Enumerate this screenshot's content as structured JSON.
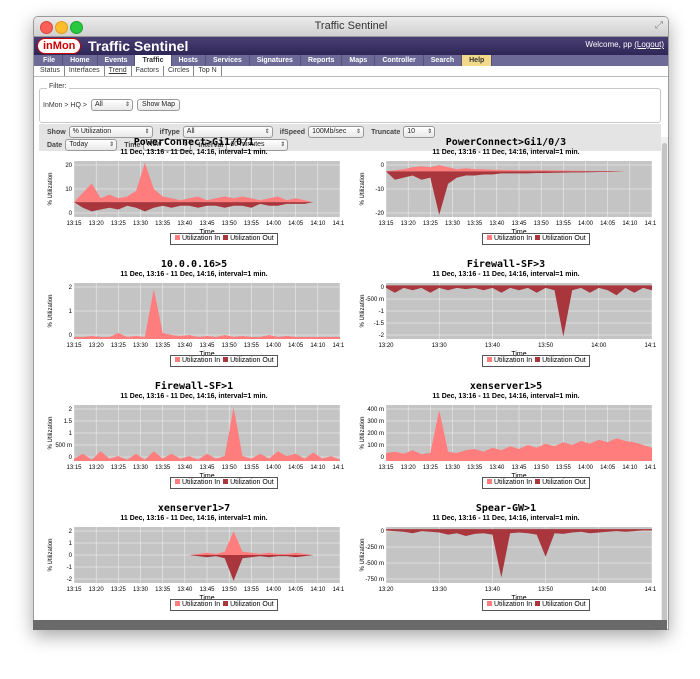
{
  "window": {
    "title": "Traffic Sentinel"
  },
  "brand": {
    "logo": "inMon",
    "app": "Traffic Sentinel",
    "welcome": "Welcome, pp",
    "logout": "(Logout)"
  },
  "menu": [
    "File",
    "Home",
    "Events",
    "Traffic",
    "Hosts",
    "Services",
    "Signatures",
    "Reports",
    "Maps",
    "Controller",
    "Search",
    "Help"
  ],
  "menu_active": "Traffic",
  "submenu": [
    "Status",
    "Interfaces",
    "Trend",
    "Factors",
    "Circles",
    "Top N"
  ],
  "submenu_active": "Trend",
  "filter": {
    "legend": "Filter:",
    "path": "InMon > HQ >",
    "scope": "All",
    "show_map": "Show Map"
  },
  "controls": {
    "show_label": "Show",
    "show_value": "% Utilization",
    "iftype_label": "ifType",
    "iftype_value": "All",
    "ifspeed_label": "ifSpeed",
    "ifspeed_value": "100Mb/sec",
    "truncate_label": "Truncate",
    "truncate_value": "10",
    "date_label": "Date",
    "date_value": "Today",
    "time_label": "Time",
    "time_value": "Now",
    "interval_label": "Interval",
    "interval_value": "60 minutes"
  },
  "common": {
    "subtitle": "11 Dec, 13:16 -  11 Dec, 14:16, interval=1 min.",
    "xlabel": "Time",
    "ylabel": "% Utilization",
    "legend_in": "Utilization In",
    "legend_out": "Utilization Out",
    "color_in": "#ff7d7d",
    "color_out": "#a8363c",
    "plot_bg": "#c4c4c4"
  },
  "chart_data": [
    {
      "type": "area",
      "title": "PowerConnect>Gi1/0/1",
      "xticks": [
        "13:15",
        "13:20",
        "13:25",
        "13:30",
        "13:35",
        "13:40",
        "13:45",
        "13:50",
        "13:55",
        "14:00",
        "14:05",
        "14:10",
        "14:15"
      ],
      "yticks": [
        "20",
        "10",
        "0"
      ],
      "ylim": [
        -8,
        22
      ],
      "in": [
        0,
        5,
        10,
        2,
        4,
        2,
        3,
        6,
        21,
        7,
        3,
        2,
        1,
        2,
        3,
        1,
        2,
        3,
        2,
        3,
        2,
        1,
        2,
        3,
        1,
        2,
        1,
        0,
        0,
        0,
        0
      ],
      "out": [
        0,
        -3,
        -5,
        -4,
        -3,
        -4,
        -2,
        -3,
        -5,
        -3,
        -2,
        -3,
        -2,
        -2,
        -3,
        -2,
        -2,
        -3,
        -2,
        -2,
        -3,
        -1,
        -2,
        -2,
        -1,
        -1,
        -1,
        0,
        0,
        0,
        0
      ]
    },
    {
      "type": "area",
      "title": "PowerConnect>Gi1/0/3",
      "xticks": [
        "13:15",
        "13:20",
        "13:25",
        "13:30",
        "13:35",
        "13:40",
        "13:45",
        "13:50",
        "13:55",
        "14:00",
        "14:05",
        "14:10",
        "14:15"
      ],
      "yticks": [
        "0",
        "-10",
        "-20"
      ],
      "ylim": [
        -22,
        5
      ],
      "in": [
        0,
        0.5,
        1,
        2,
        2.5,
        2,
        3,
        2,
        1,
        1.5,
        1,
        1,
        0.8,
        0.7,
        0.6,
        0.5,
        0.5,
        0.5,
        0.5,
        0.4,
        0.4,
        0.3,
        0.3,
        0.2,
        0.2,
        0.2,
        0.1,
        0,
        0,
        0,
        0
      ],
      "out": [
        0,
        -4,
        -3,
        -2,
        -4,
        -3,
        -21,
        -6,
        -3,
        -2,
        -2,
        -1.5,
        -1.5,
        -1,
        -1,
        -1,
        -1,
        -0.8,
        -0.8,
        -0.7,
        -0.6,
        -0.5,
        -0.5,
        -0.4,
        -0.3,
        -0.3,
        -0.2,
        0,
        0,
        0,
        0
      ]
    },
    {
      "type": "area",
      "title": "10.0.0.16>5",
      "xticks": [
        "13:15",
        "13:20",
        "13:25",
        "13:30",
        "13:35",
        "13:40",
        "13:45",
        "13:50",
        "13:55",
        "14:00",
        "14:05",
        "14:10",
        "14:15"
      ],
      "yticks": [
        "2",
        "1",
        "0"
      ],
      "ylim": [
        0,
        2.8
      ],
      "in": [
        0.1,
        0.1,
        0.15,
        0.1,
        0.1,
        0.3,
        0.1,
        0.15,
        0.1,
        2.5,
        0.3,
        0.2,
        0.15,
        0.2,
        0.1,
        0.15,
        0.1,
        0.2,
        0.1,
        0.15,
        0.1,
        0.1,
        0.2,
        0.1,
        0.15,
        0.1,
        0.1,
        0.1,
        0.1,
        0.1,
        0.1
      ],
      "out": [
        0,
        0,
        0,
        0,
        0,
        0,
        0,
        0,
        0,
        0,
        0,
        0,
        0,
        0,
        0,
        0,
        0,
        0,
        0,
        0,
        0,
        0,
        0,
        0,
        0,
        0,
        0,
        0,
        0,
        0,
        0
      ]
    },
    {
      "type": "area",
      "title": "Firewall-SF>3",
      "xticks": [
        "13:20",
        "13:30",
        "13:40",
        "13:50",
        "14:00",
        "14:10"
      ],
      "yticks": [
        "0",
        "-500 m",
        "-1",
        "-1.5",
        "-2"
      ],
      "ylim": [
        -2.2,
        0.1
      ],
      "in": [
        0,
        0,
        0,
        0,
        0,
        0,
        0,
        0,
        0,
        0,
        0,
        0,
        0,
        0,
        0,
        0,
        0,
        0,
        0,
        0,
        0,
        0,
        0,
        0,
        0,
        0,
        0,
        0,
        0,
        0,
        0
      ],
      "out": [
        -0.1,
        -0.3,
        -0.1,
        -0.2,
        -0.1,
        -0.3,
        -0.1,
        -0.2,
        -0.1,
        -0.15,
        -0.1,
        -0.2,
        -0.1,
        -0.3,
        -0.1,
        -0.2,
        -0.1,
        -0.3,
        -0.1,
        -0.2,
        -2.1,
        -0.2,
        -0.1,
        -0.3,
        -0.1,
        -0.2,
        -0.4,
        -0.1,
        -0.3,
        -0.1,
        -0.2
      ]
    },
    {
      "type": "area",
      "title": "Firewall-SF>1",
      "xticks": [
        "13:15",
        "13:20",
        "13:25",
        "13:30",
        "13:35",
        "13:40",
        "13:45",
        "13:50",
        "13:55",
        "14:00",
        "14:05",
        "14:10",
        "14:15"
      ],
      "yticks": [
        "2",
        "1.5",
        "1",
        "500 m",
        "0"
      ],
      "ylim": [
        0,
        2.3
      ],
      "in": [
        0.1,
        0.3,
        0.05,
        0.4,
        0.1,
        0.2,
        0.05,
        0.3,
        0.05,
        0.4,
        0.1,
        0.3,
        0.1,
        0.2,
        0.05,
        0.3,
        0.1,
        0.2,
        2.2,
        0.2,
        0.1,
        0.3,
        0.1,
        0.4,
        0.2,
        0.3,
        0.1,
        0.35,
        0.1,
        0.2,
        0.05
      ],
      "out": [
        0,
        0,
        0,
        0,
        0,
        0,
        0,
        0,
        0,
        0,
        0,
        0,
        0,
        0,
        0,
        0,
        0,
        0,
        0,
        0,
        0,
        0,
        0,
        0,
        0,
        0,
        0,
        0,
        0,
        0,
        0
      ]
    },
    {
      "type": "area",
      "title": "xenserver1>5",
      "xticks": [
        "13:15",
        "13:20",
        "13:25",
        "13:30",
        "13:35",
        "13:40",
        "13:45",
        "13:50",
        "13:55",
        "14:00",
        "14:05",
        "14:10",
        "14:15"
      ],
      "yticks": [
        "400 m",
        "300 m",
        "200 m",
        "100 m",
        "0"
      ],
      "ylim": [
        0,
        420
      ],
      "in": [
        60,
        70,
        55,
        80,
        50,
        60,
        380,
        70,
        60,
        80,
        90,
        70,
        100,
        80,
        110,
        90,
        120,
        100,
        130,
        110,
        140,
        120,
        150,
        130,
        160,
        140,
        170,
        150,
        140,
        120,
        100
      ],
      "out": [
        0,
        0,
        0,
        0,
        0,
        0,
        0,
        0,
        0,
        0,
        0,
        0,
        0,
        0,
        0,
        0,
        0,
        0,
        0,
        0,
        0,
        0,
        0,
        0,
        0,
        0,
        0,
        0,
        0,
        0,
        0
      ]
    },
    {
      "type": "area",
      "title": "xenserver1>7",
      "xticks": [
        "13:15",
        "13:20",
        "13:25",
        "13:30",
        "13:35",
        "13:40",
        "13:45",
        "13:50",
        "13:55",
        "14:00",
        "14:05",
        "14:10",
        "14:15"
      ],
      "yticks": [
        "2",
        "1",
        "0",
        "-1",
        "-2"
      ],
      "ylim": [
        -2.6,
        2.6
      ],
      "in": [
        0,
        0,
        0,
        0,
        0,
        0,
        0,
        0,
        0,
        0,
        0,
        0,
        0,
        0,
        0.1,
        0.2,
        0.1,
        0.3,
        2.2,
        0.3,
        0.2,
        0.1,
        0.2,
        0.1,
        0.1,
        0.2,
        0.1,
        0,
        0,
        0,
        0
      ],
      "out": [
        0,
        0,
        0,
        0,
        0,
        0,
        0,
        0,
        0,
        0,
        0,
        0,
        0,
        0,
        -0.1,
        -0.2,
        -0.1,
        -0.3,
        -2.4,
        -0.3,
        -0.2,
        -0.1,
        -0.2,
        -0.1,
        -0.1,
        -0.2,
        -0.1,
        0,
        0,
        0,
        0
      ]
    },
    {
      "type": "area",
      "title": "Spear-GW>1",
      "xticks": [
        "13:20",
        "13:30",
        "13:40",
        "13:50",
        "14:00",
        "14:10"
      ],
      "yticks": [
        "0",
        "-250 m",
        "-500 m",
        "-750 m"
      ],
      "ylim": [
        -780,
        30
      ],
      "in": [
        0,
        0,
        0,
        0,
        0,
        0,
        0,
        0,
        0,
        0,
        0,
        0,
        0,
        0,
        0,
        0,
        0,
        0,
        0,
        0,
        0,
        0,
        0,
        0,
        0,
        0,
        0,
        0,
        0,
        0,
        0
      ],
      "out": [
        -20,
        -30,
        -40,
        -60,
        -30,
        -40,
        -50,
        -80,
        -60,
        -100,
        -70,
        -60,
        -80,
        -700,
        -60,
        -50,
        -60,
        -80,
        -400,
        -60,
        -70,
        -50,
        -40,
        -60,
        -50,
        -40,
        -30,
        -40,
        -30,
        -20,
        -20
      ]
    }
  ]
}
